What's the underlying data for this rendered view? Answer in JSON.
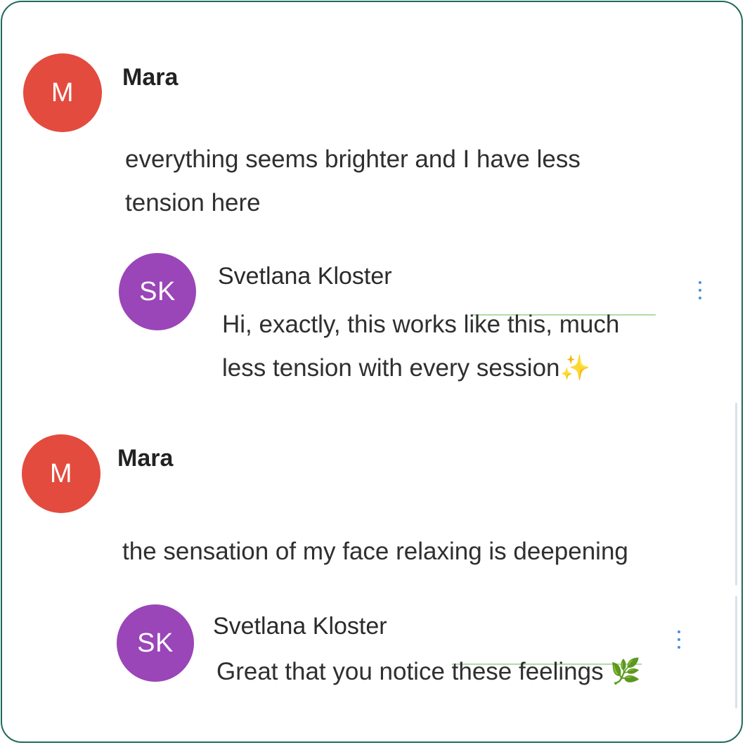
{
  "colors": {
    "mara_avatar": "#e34b3e",
    "sk_avatar": "#9a45b8",
    "border": "#1e6b5a",
    "menu_dots": "#4a90d9"
  },
  "thread": [
    {
      "author": {
        "name": "Mara",
        "initials": "M"
      },
      "text_lines": [
        "everything seems brighter and I have less",
        "tension here"
      ],
      "reply": {
        "author": {
          "name": "Svetlana Kloster",
          "initials": "SK"
        },
        "text_lines": [
          "Hi, exactly, this works like this, much",
          "less tension with every session"
        ],
        "emoji": "✨",
        "menu_icon": "more-vertical-icon"
      }
    },
    {
      "author": {
        "name": "Mara",
        "initials": "M"
      },
      "text_lines": [
        "the sensation of my face relaxing is deepening"
      ],
      "reply": {
        "author": {
          "name": "Svetlana Kloster",
          "initials": "SK"
        },
        "text_lines": [
          "Great that you notice these feelings"
        ],
        "emoji": "🌿",
        "menu_icon": "more-vertical-icon"
      }
    }
  ]
}
